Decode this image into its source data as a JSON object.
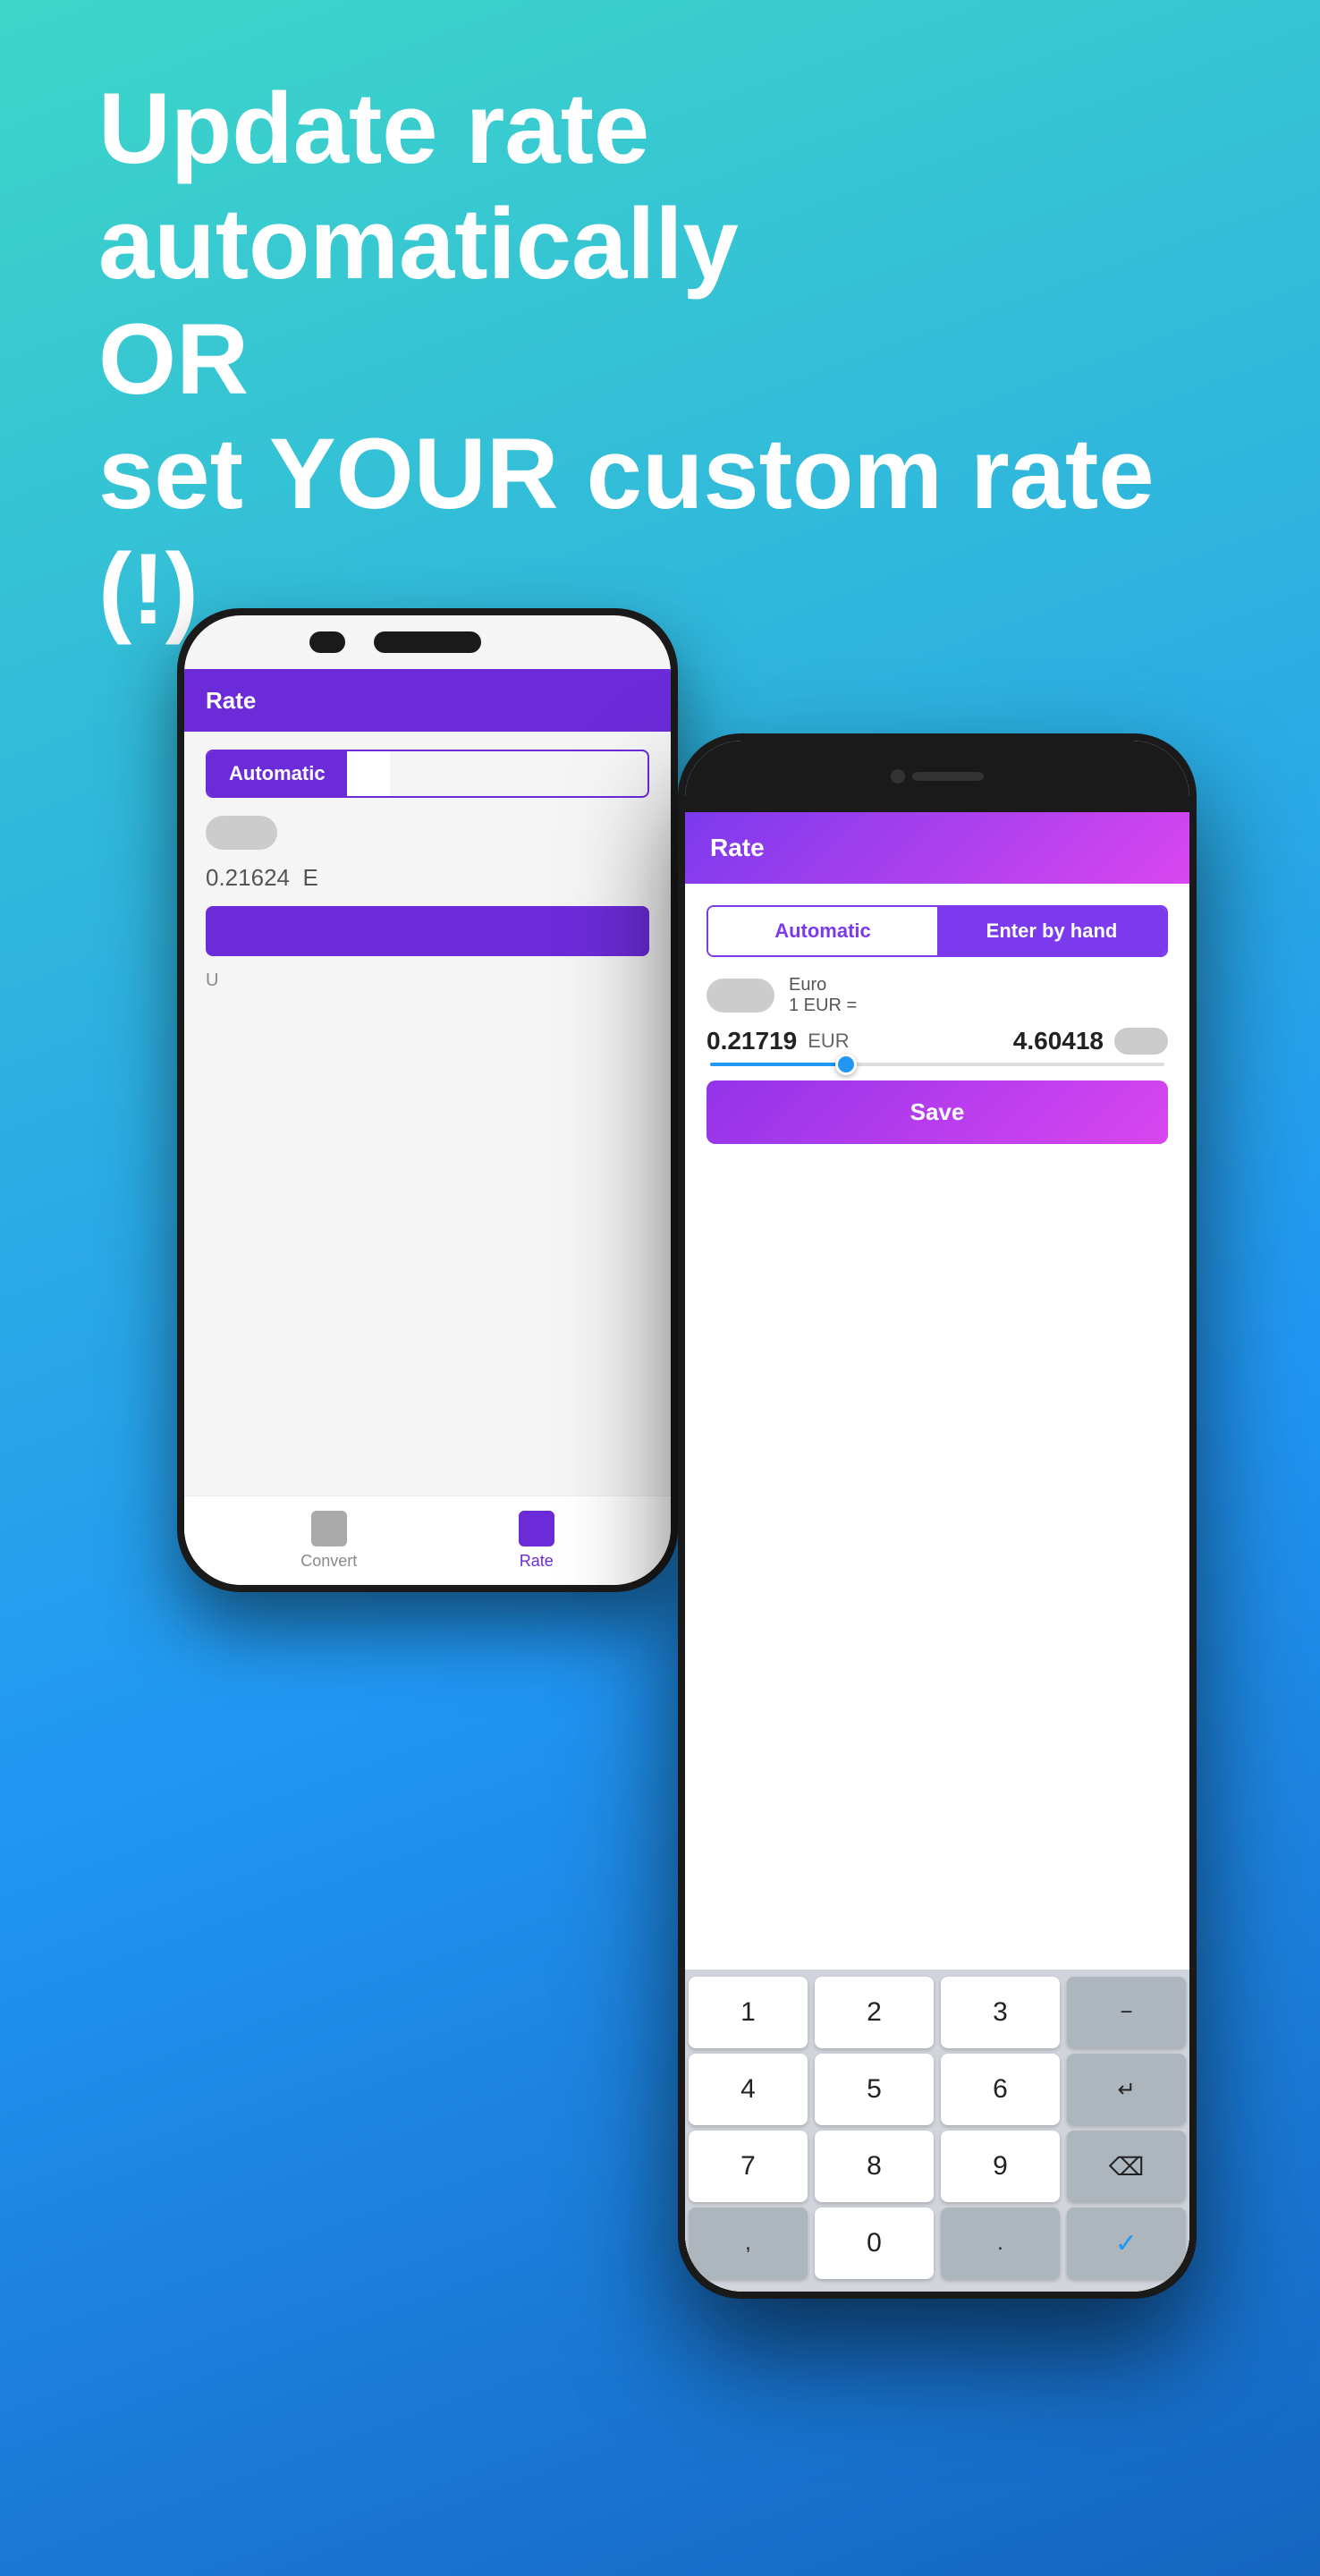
{
  "hero": {
    "line1": "Update rate automatically",
    "line2": "OR",
    "line3": "set YOUR custom rate (!)"
  },
  "back_phone": {
    "title": "Rate",
    "tab_auto": "Automatic",
    "value_display": "0.21624",
    "value_unit": "E",
    "nav_convert": "Convert",
    "nav_rate": "Rate"
  },
  "front_phone": {
    "title": "Rate",
    "tab_auto": "Automatic",
    "tab_manual": "Enter by hand",
    "currency_name": "Euro",
    "currency_eq": "1 EUR =",
    "value_left": "0.21719",
    "unit": "EUR",
    "value_right": "4.60418",
    "save_label": "Save",
    "keyboard": {
      "rows": [
        [
          "1",
          "2",
          "3",
          "−"
        ],
        [
          "4",
          "5",
          "6",
          "↵"
        ],
        [
          "7",
          "8",
          "9",
          "⌫"
        ],
        [
          ",",
          "0",
          ".",
          "✓"
        ]
      ]
    }
  },
  "colors": {
    "gradient_start": "#3dd6c8",
    "gradient_mid": "#2196f3",
    "gradient_end": "#1565c0",
    "purple": "#7c3aed",
    "pink_gradient": "#d946ef",
    "white": "#ffffff"
  }
}
